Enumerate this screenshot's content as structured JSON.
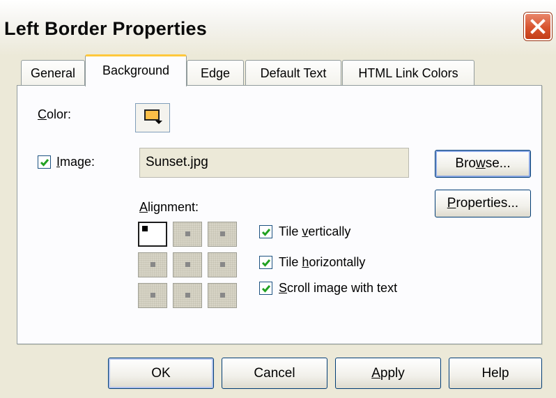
{
  "window": {
    "title": "Left Border Properties"
  },
  "tabs": [
    {
      "label": "General",
      "active": false
    },
    {
      "label": "Background",
      "active": true
    },
    {
      "label": "Edge",
      "active": false
    },
    {
      "label": "Default Text",
      "active": false
    },
    {
      "label": "HTML Link Colors",
      "active": false
    }
  ],
  "background_tab": {
    "color": {
      "label_first": "C",
      "label_rest": "olor:",
      "swatch_color": "#fcbf48"
    },
    "image": {
      "label_first": "I",
      "label_rest": "mage:",
      "checked": true,
      "value": "Sunset.jpg"
    },
    "browse_button": {
      "label_a": "Bro",
      "label_u": "w",
      "label_b": "se..."
    },
    "properties_button": {
      "label_u": "P",
      "label_rest": "roperties..."
    },
    "alignment": {
      "label_first": "A",
      "label_rest": "lignment:",
      "selected": "top-left"
    },
    "options": {
      "tile_vertically": {
        "pre": "Tile ",
        "u": "v",
        "post": "ertically",
        "checked": true
      },
      "tile_horizontally": {
        "pre": "Tile ",
        "u": "h",
        "post": "orizontally",
        "checked": true
      },
      "scroll_with_text": {
        "pre": "",
        "u": "S",
        "post": "croll image with text",
        "checked": true
      }
    }
  },
  "footer": {
    "ok": "OK",
    "cancel": "Cancel",
    "apply_u": "A",
    "apply_rest": "pply",
    "help": "Help"
  },
  "colors": {
    "checkmark": "#21a121",
    "close_button": "#d8532e",
    "tab_highlight": "#ffc83c"
  }
}
